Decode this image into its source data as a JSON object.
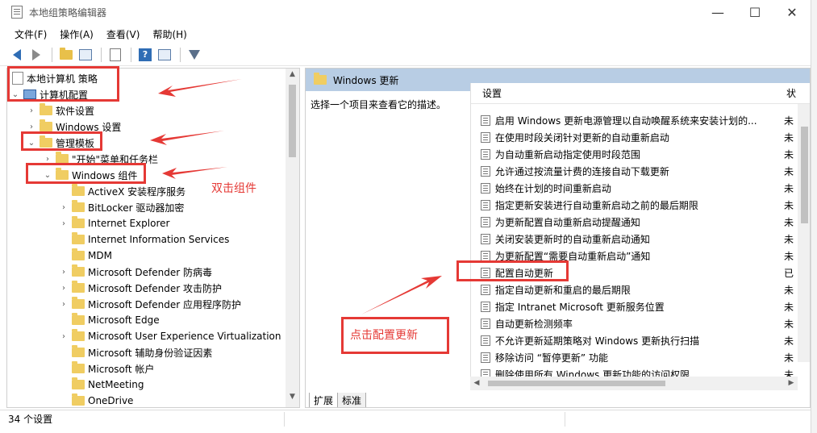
{
  "window": {
    "title": "本地组策略编辑器",
    "buttons": {
      "minimize": "—",
      "maximize": "☐",
      "close": "✕"
    }
  },
  "menu": [
    "文件(F)",
    "操作(A)",
    "查看(V)",
    "帮助(H)"
  ],
  "tree": [
    {
      "label": "本地计算机 策略",
      "icon": "document-icon"
    },
    {
      "label": "计算机配置",
      "icon": "computer-icon",
      "chevron": "⌄"
    },
    {
      "label": "软件设置",
      "icon": "folder-icon",
      "chevron": "›"
    },
    {
      "label": "Windows 设置",
      "icon": "folder-icon",
      "chevron": "›"
    },
    {
      "label": "管理模板",
      "icon": "folder-icon",
      "chevron": "⌄"
    },
    {
      "label": "\"开始\"菜单和任务栏",
      "icon": "folder-icon",
      "chevron": "›"
    },
    {
      "label": "Windows 组件",
      "icon": "folder-icon",
      "chevron": "⌄"
    },
    {
      "label": "ActiveX 安装程序服务",
      "icon": "folder-icon",
      "chevron": ""
    },
    {
      "label": "BitLocker 驱动器加密",
      "icon": "folder-icon",
      "chevron": "›"
    },
    {
      "label": "Internet Explorer",
      "icon": "folder-icon",
      "chevron": "›"
    },
    {
      "label": "Internet Information Services",
      "icon": "folder-icon",
      "chevron": ""
    },
    {
      "label": "MDM",
      "icon": "folder-icon",
      "chevron": ""
    },
    {
      "label": "Microsoft Defender 防病毒",
      "icon": "folder-icon",
      "chevron": "›"
    },
    {
      "label": "Microsoft Defender 攻击防护",
      "icon": "folder-icon",
      "chevron": "›"
    },
    {
      "label": "Microsoft Defender 应用程序防护",
      "icon": "folder-icon",
      "chevron": "›"
    },
    {
      "label": "Microsoft Edge",
      "icon": "folder-icon",
      "chevron": ""
    },
    {
      "label": "Microsoft User Experience Virtualization",
      "icon": "folder-icon",
      "chevron": "›"
    },
    {
      "label": "Microsoft 辅助身份验证因素",
      "icon": "folder-icon",
      "chevron": ""
    },
    {
      "label": "Microsoft 帐户",
      "icon": "folder-icon",
      "chevron": ""
    },
    {
      "label": "NetMeeting",
      "icon": "folder-icon",
      "chevron": ""
    },
    {
      "label": "OneDrive",
      "icon": "folder-icon",
      "chevron": ""
    }
  ],
  "right": {
    "header": "Windows 更新",
    "description": "选择一个项目来查看它的描述。",
    "columns": [
      "设置",
      "状"
    ],
    "rows": [
      {
        "name": "启用 Windows 更新电源管理以自动唤醒系统来安装计划的...",
        "state": "未"
      },
      {
        "name": "在使用时段关闭针对更新的自动重新启动",
        "state": "未"
      },
      {
        "name": "为自动重新启动指定使用时段范围",
        "state": "未"
      },
      {
        "name": "允许通过按流量计费的连接自动下载更新",
        "state": "未"
      },
      {
        "name": "始终在计划的时间重新启动",
        "state": "未"
      },
      {
        "name": "指定更新安装进行自动重新启动之前的最后期限",
        "state": "未"
      },
      {
        "name": "为更新配置自动重新启动提醒通知",
        "state": "未"
      },
      {
        "name": "关闭安装更新时的自动重新启动通知",
        "state": "未"
      },
      {
        "name": "为更新配置“需要自动重新启动”通知",
        "state": "未"
      },
      {
        "name": "配置自动更新",
        "state": "已"
      },
      {
        "name": "指定自动更新和重启的最后期限",
        "state": "未"
      },
      {
        "name": "指定 Intranet Microsoft 更新服务位置",
        "state": "未"
      },
      {
        "name": "自动更新检测频率",
        "state": "未"
      },
      {
        "name": "不允许更新延期策略对 Windows 更新执行扫描",
        "state": "未"
      },
      {
        "name": "移除访问 “暂停更新” 功能",
        "state": "未"
      },
      {
        "name": "删除使用所有 Windows 更新功能的访问权限",
        "state": "未"
      }
    ],
    "tabs": [
      "扩展",
      "标准"
    ]
  },
  "status": "34 个设置",
  "annotations": {
    "double_click": "双击组件",
    "click_config": "点击配置更新"
  },
  "colors": {
    "annotation_red": "#e53935",
    "header_blue": "#b8cde4",
    "folder_yellow": "#f0cd62"
  }
}
